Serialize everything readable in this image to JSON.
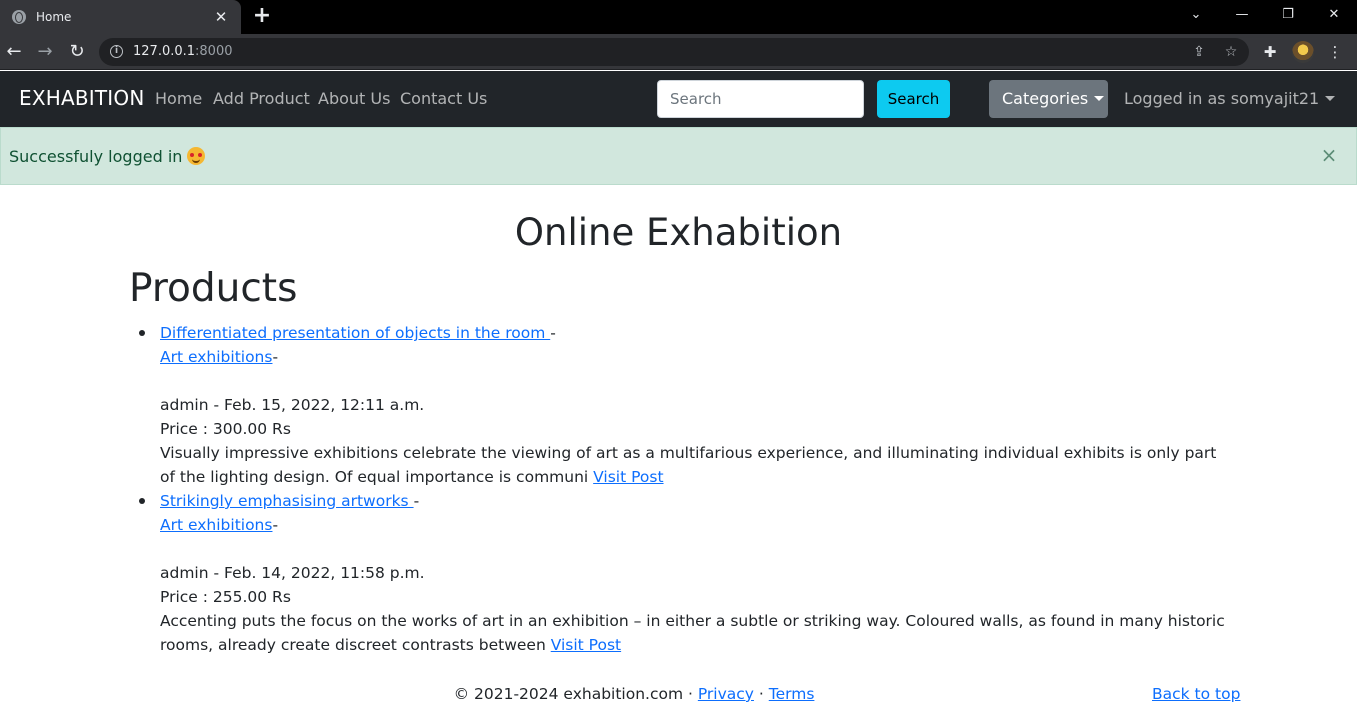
{
  "browser": {
    "tab_title": "Home",
    "url_host": "127.0.0.1",
    "url_port": ":8000"
  },
  "navbar": {
    "brand": "EXHABITION",
    "links": [
      "Home",
      "Add Product",
      "About Us",
      "Contact Us"
    ],
    "search_placeholder": "Search",
    "search_button": "Search",
    "categories_button": "Categories",
    "user_menu": "Logged in as somyajit21"
  },
  "alert": {
    "message": "Successfuly logged in",
    "close": "×"
  },
  "main": {
    "title": "Online Exhabition",
    "section_title": "Products",
    "products": [
      {
        "title": "Differentiated presentation of objects in the room ",
        "category": "Art exhibitions",
        "meta": "admin - Feb. 15, 2022, 12:11 a.m.",
        "price": "Price : 300.00 Rs",
        "excerpt": "Visually impressive exhibitions celebrate the viewing of art as a multifarious experience, and illuminating individual exhibits is only part of the lighting design. Of equal importance is communi",
        "link": "Visit Post"
      },
      {
        "title": "Strikingly emphasising artworks ",
        "category": "Art exhibitions",
        "meta": "admin - Feb. 14, 2022, 11:58 p.m.",
        "price": "Price : 255.00 Rs",
        "excerpt": "Accenting puts the focus on the works of art in an exhibition – in either a subtle or striking way. Coloured walls, as found in many historic rooms, already create discreet contrasts between",
        "link": "Visit Post"
      }
    ]
  },
  "footer": {
    "copyright": "© 2021-2024 exhabition.com · ",
    "privacy": "Privacy",
    "sep": " · ",
    "terms": "Terms",
    "back_to_top": "Back to top"
  }
}
